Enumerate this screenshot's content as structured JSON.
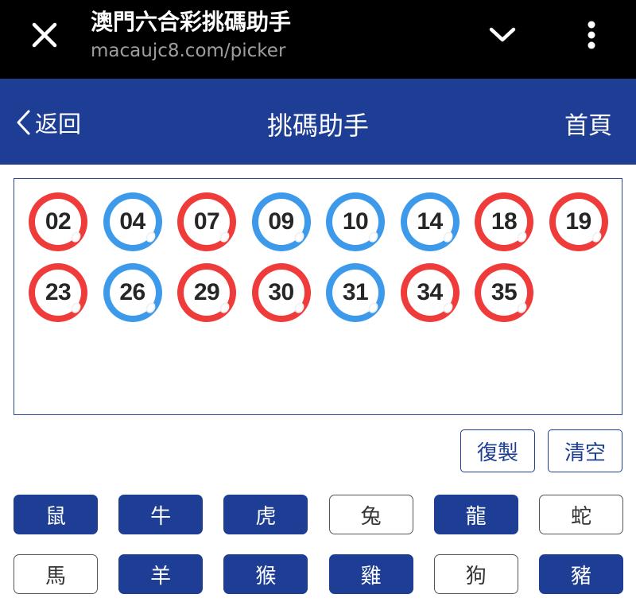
{
  "browser": {
    "title": "澳門六合彩挑碼助手",
    "url": "macaujc8.com/picker"
  },
  "header": {
    "back_label": "返回",
    "title": "挑碼助手",
    "home_label": "首頁"
  },
  "balls": [
    {
      "number": "02",
      "color": "red"
    },
    {
      "number": "04",
      "color": "blue"
    },
    {
      "number": "07",
      "color": "red"
    },
    {
      "number": "09",
      "color": "blue"
    },
    {
      "number": "10",
      "color": "blue"
    },
    {
      "number": "14",
      "color": "blue"
    },
    {
      "number": "18",
      "color": "red"
    },
    {
      "number": "19",
      "color": "red"
    },
    {
      "number": "23",
      "color": "red"
    },
    {
      "number": "26",
      "color": "blue"
    },
    {
      "number": "29",
      "color": "red"
    },
    {
      "number": "30",
      "color": "red"
    },
    {
      "number": "31",
      "color": "blue"
    },
    {
      "number": "34",
      "color": "red"
    },
    {
      "number": "35",
      "color": "red"
    }
  ],
  "actions": {
    "copy_label": "復製",
    "clear_label": "清空"
  },
  "zodiacs": [
    {
      "label": "鼠",
      "selected": true
    },
    {
      "label": "牛",
      "selected": true
    },
    {
      "label": "虎",
      "selected": true
    },
    {
      "label": "兔",
      "selected": false
    },
    {
      "label": "龍",
      "selected": true
    },
    {
      "label": "蛇",
      "selected": false
    },
    {
      "label": "馬",
      "selected": false
    },
    {
      "label": "羊",
      "selected": true
    },
    {
      "label": "猴",
      "selected": true
    },
    {
      "label": "雞",
      "selected": true
    },
    {
      "label": "狗",
      "selected": false
    },
    {
      "label": "豬",
      "selected": true
    }
  ],
  "colors": {
    "brand_blue": "#1d3e94",
    "ball_red": "#ef3b3a",
    "ball_blue": "#3d99ea"
  },
  "icons": {
    "close": "close-icon",
    "chevron": "chevron-down-icon",
    "menu": "more-vert-icon",
    "back": "chevron-left-icon"
  }
}
